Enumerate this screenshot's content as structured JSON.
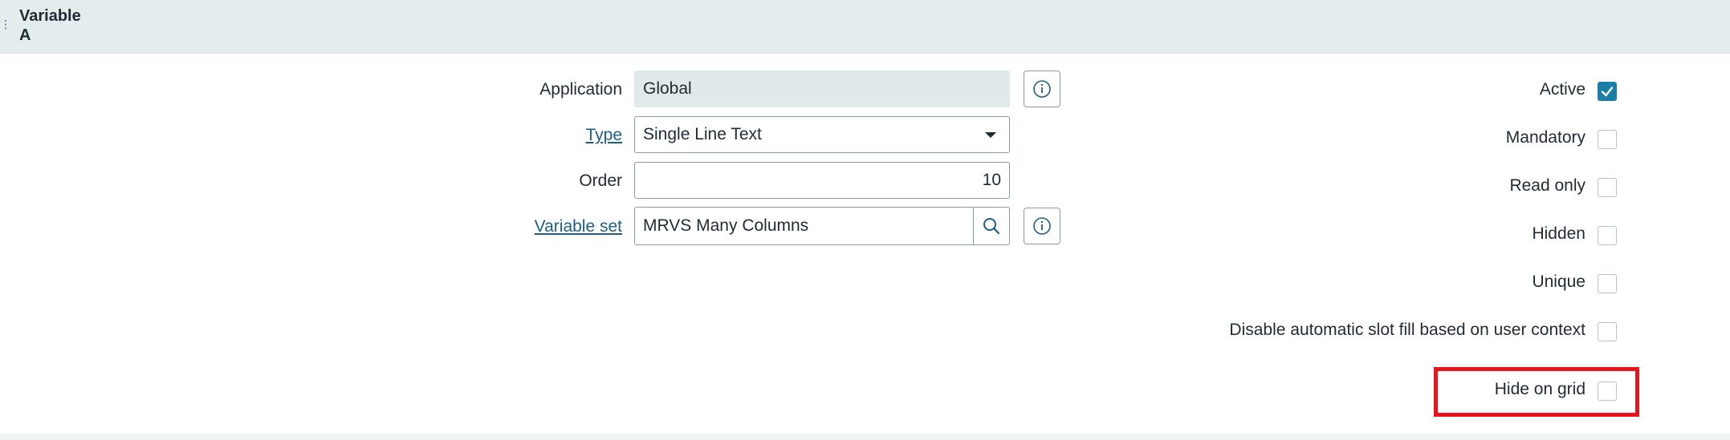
{
  "header": {
    "title_line1": "Variable",
    "title_line2": "A"
  },
  "form": {
    "application": {
      "label": "Application",
      "value": "Global"
    },
    "type": {
      "label": "Type",
      "value": "Single Line Text"
    },
    "order": {
      "label": "Order",
      "value": "10"
    },
    "variable_set": {
      "label": "Variable set",
      "value": "MRVS Many Columns"
    }
  },
  "checkboxes": {
    "active": {
      "label": "Active",
      "checked": true
    },
    "mandatory": {
      "label": "Mandatory",
      "checked": false
    },
    "read_only": {
      "label": "Read only",
      "checked": false
    },
    "hidden": {
      "label": "Hidden",
      "checked": false
    },
    "unique": {
      "label": "Unique",
      "checked": false
    },
    "disable_slot_fill": {
      "label": "Disable automatic slot fill based on user context",
      "checked": false
    },
    "hide_on_grid": {
      "label": "Hide on grid",
      "checked": false
    }
  },
  "icons": {
    "info": "info-icon",
    "search": "search-icon",
    "check": "check-icon",
    "caret": "chevron-down-icon"
  },
  "colors": {
    "header_bg": "#e5ecee",
    "link": "#1d5f86",
    "accent": "#1b7ea6",
    "highlight": "#e8141c"
  }
}
